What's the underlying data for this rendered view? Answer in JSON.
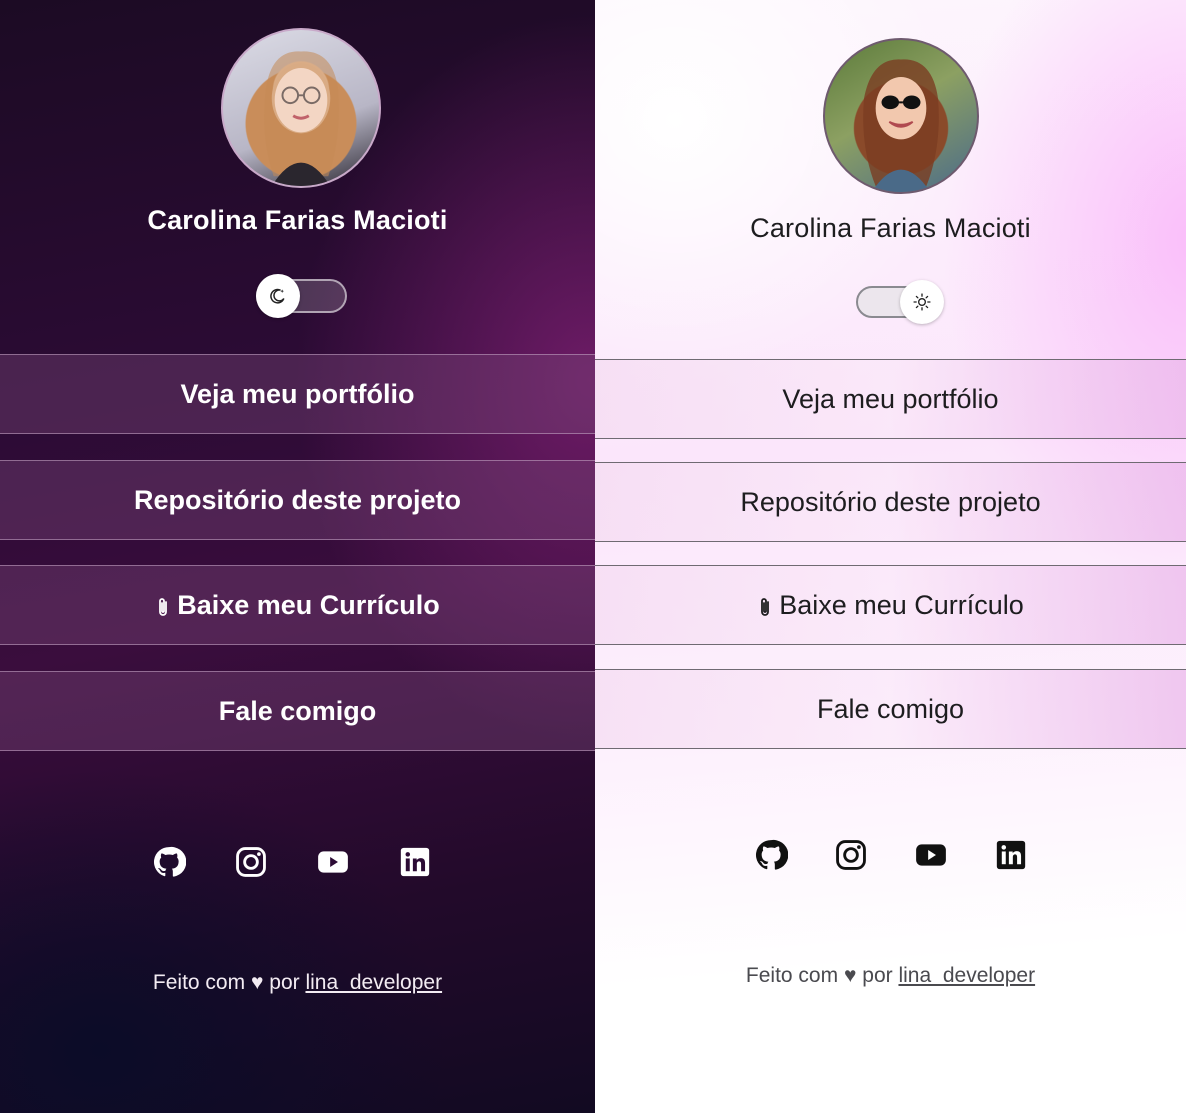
{
  "dark_panel": {
    "profile_name": "Carolina Farias Macioti",
    "theme_toggle_icon": "moon-icon",
    "buttons": [
      {
        "label": "Veja meu portfólio"
      },
      {
        "label": "Repositório deste projeto"
      },
      {
        "label": "Baixe meu Currículo",
        "icon": "paperclip-icon"
      },
      {
        "label": "Fale comigo"
      }
    ],
    "socials": [
      "github-icon",
      "instagram-icon",
      "youtube-icon",
      "linkedin-icon"
    ],
    "footer": {
      "prefix": "Feito com",
      "heart": "♥",
      "middle": "por",
      "link": "lina_developer"
    }
  },
  "light_panel": {
    "profile_name": "Carolina Farias Macioti",
    "theme_toggle_icon": "sun-icon",
    "buttons": [
      {
        "label": "Veja meu portfólio"
      },
      {
        "label": "Repositório deste projeto"
      },
      {
        "label": "Baixe meu Currículo",
        "icon": "paperclip-icon"
      },
      {
        "label": "Fale comigo"
      }
    ],
    "socials": [
      "github-icon",
      "instagram-icon",
      "youtube-icon",
      "linkedin-icon"
    ],
    "footer": {
      "prefix": "Feito com",
      "heart": "♥",
      "middle": "por",
      "link": "lina_developer"
    }
  },
  "colors": {
    "dark_bg": "#2c0b35",
    "dark_accent": "#78467a",
    "light_bg": "#fbe6fb",
    "light_accent": "#ebb9eb",
    "dark_text": "#ffffff",
    "light_text": "#1d1d1f"
  }
}
